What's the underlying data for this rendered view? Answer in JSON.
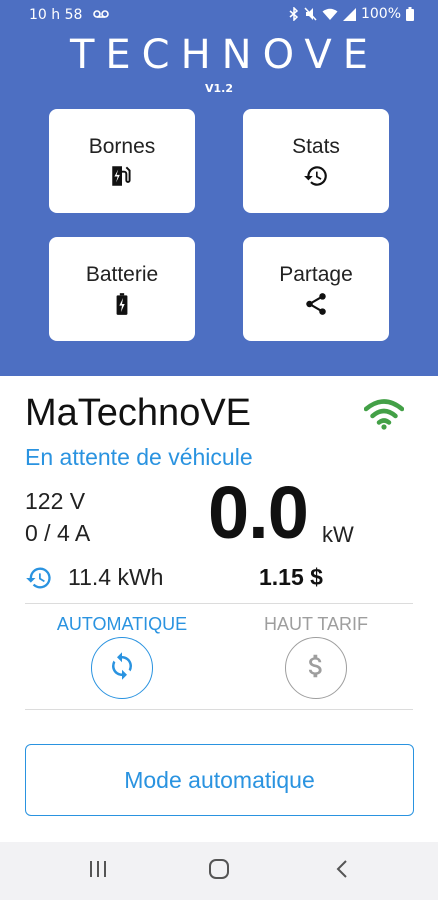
{
  "status_bar": {
    "time": "10 h 58",
    "battery": "100%",
    "icons": [
      "voicemail-icon",
      "bluetooth-icon",
      "mute-icon",
      "wifi-icon",
      "signal-icon",
      "battery-icon"
    ]
  },
  "app": {
    "brand": "TECHNOVE",
    "version": "V1.2"
  },
  "menu": {
    "bornes": {
      "label": "Bornes",
      "icon": "ev-station-icon"
    },
    "stats": {
      "label": "Stats",
      "icon": "history-icon"
    },
    "batterie": {
      "label": "Batterie",
      "icon": "battery-charging-icon"
    },
    "partage": {
      "label": "Partage",
      "icon": "share-icon"
    }
  },
  "station": {
    "name": "MaTechnoVE",
    "status": "En attente de véhicule",
    "voltage": "122 V",
    "current": "0 / 4 A",
    "power": "0.0",
    "power_unit": "kW",
    "energy": "11.4 kWh",
    "cost": "1.15 $",
    "wifi_color": "#43a047"
  },
  "modes": {
    "auto_label": "AUTOMATIQUE",
    "peak_label": "HAUT TARIF",
    "active_color": "#2a93e0",
    "inactive_color": "#9e9e9e"
  },
  "mode_button": {
    "label": "Mode automatique"
  },
  "nav": {
    "icons": [
      "recent-apps-icon",
      "home-icon",
      "back-icon"
    ]
  }
}
